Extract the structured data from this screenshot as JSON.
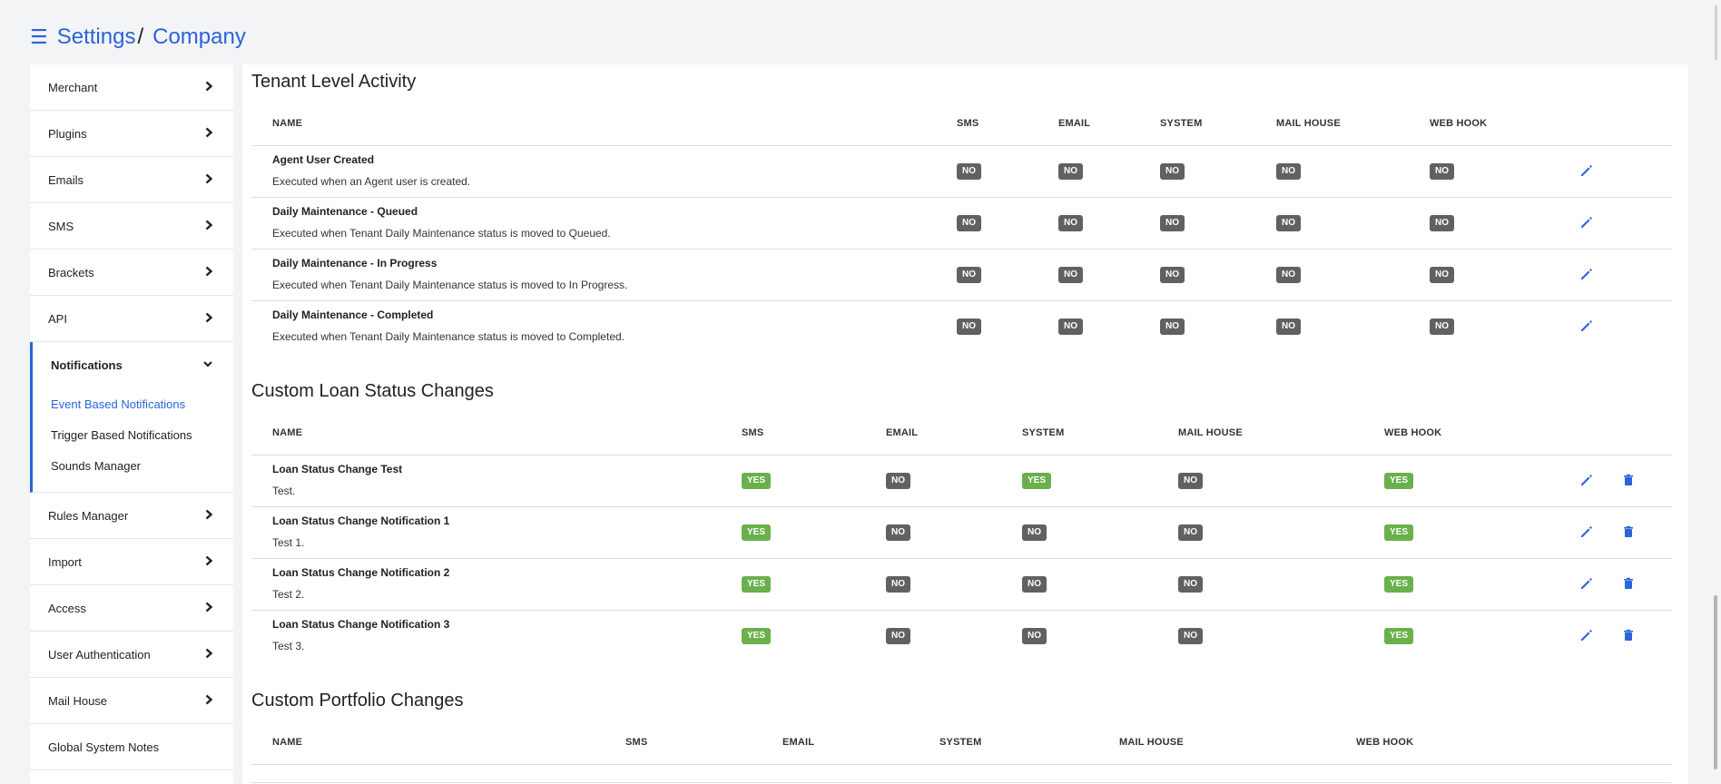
{
  "header": {
    "menu_icon": "hamburger-icon",
    "crumb_root": "Settings",
    "crumb_sep": "/",
    "crumb_current": "Company"
  },
  "sidebar": {
    "items_top": [
      {
        "label": "Merchant"
      },
      {
        "label": "Plugins"
      },
      {
        "label": "Emails"
      },
      {
        "label": "SMS"
      },
      {
        "label": "Brackets"
      },
      {
        "label": "API"
      }
    ],
    "group": {
      "label": "Notifications",
      "subitems": [
        {
          "label": "Event Based Notifications",
          "active": true
        },
        {
          "label": "Trigger Based Notifications"
        },
        {
          "label": "Sounds Manager"
        }
      ]
    },
    "items_bottom": [
      {
        "label": "Rules Manager"
      },
      {
        "label": "Import"
      },
      {
        "label": "Access"
      },
      {
        "label": "User Authentication"
      },
      {
        "label": "Mail House"
      },
      {
        "label": "Global System Notes"
      }
    ]
  },
  "tenant": {
    "title": "Tenant Level Activity",
    "columns": [
      "NAME",
      "SMS",
      "EMAIL",
      "SYSTEM",
      "MAIL HOUSE",
      "WEB HOOK"
    ],
    "rows": [
      {
        "name": "Agent User Created",
        "desc": "Executed when an Agent user is created.",
        "values": [
          "NO",
          "NO",
          "NO",
          "NO",
          "NO"
        ]
      },
      {
        "name": "Daily Maintenance - Queued",
        "desc": "Executed when Tenant Daily Maintenance status is moved to Queued.",
        "values": [
          "NO",
          "NO",
          "NO",
          "NO",
          "NO"
        ]
      },
      {
        "name": "Daily Maintenance - In Progress",
        "desc": "Executed when Tenant Daily Maintenance status is moved to In Progress.",
        "values": [
          "NO",
          "NO",
          "NO",
          "NO",
          "NO"
        ]
      },
      {
        "name": "Daily Maintenance - Completed",
        "desc": "Executed when Tenant Daily Maintenance status is moved to Completed.",
        "values": [
          "NO",
          "NO",
          "NO",
          "NO",
          "NO"
        ]
      }
    ]
  },
  "loan": {
    "title": "Custom Loan Status Changes",
    "columns": [
      "NAME",
      "SMS",
      "EMAIL",
      "SYSTEM",
      "MAIL HOUSE",
      "WEB HOOK"
    ],
    "rows": [
      {
        "name": "Loan Status Change Test",
        "desc": "Test.",
        "values": [
          "YES",
          "NO",
          "YES",
          "NO",
          "YES"
        ]
      },
      {
        "name": "Loan Status Change Notification 1",
        "desc": "Test 1.",
        "values": [
          "YES",
          "NO",
          "NO",
          "NO",
          "YES"
        ]
      },
      {
        "name": "Loan Status Change Notification 2",
        "desc": "Test 2.",
        "values": [
          "YES",
          "NO",
          "NO",
          "NO",
          "YES"
        ]
      },
      {
        "name": "Loan Status Change Notification 3",
        "desc": "Test 3.",
        "values": [
          "YES",
          "NO",
          "NO",
          "NO",
          "YES"
        ]
      }
    ]
  },
  "portfolio": {
    "title": "Custom Portfolio Changes",
    "columns": [
      "NAME",
      "SMS",
      "EMAIL",
      "SYSTEM",
      "MAIL HOUSE",
      "WEB HOOK"
    ]
  },
  "colors": {
    "accent": "#2b63d9",
    "yes": "#6ab04c",
    "no": "#616161"
  },
  "icons": {
    "edit": "pencil-icon",
    "delete": "trash-icon",
    "expand": "chevron-right-icon",
    "collapse": "chevron-down-icon"
  }
}
